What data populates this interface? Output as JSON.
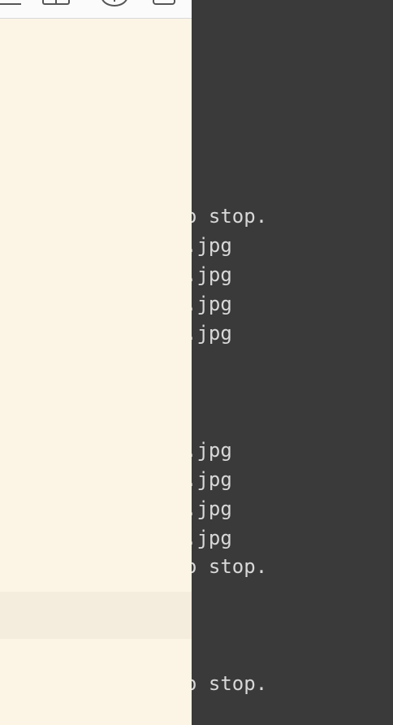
{
  "terminal": {
    "lines": [
      "o stop.",
      ".jpg",
      ".jpg",
      ".jpg",
      ".jpg",
      ".jpg",
      ".jpg",
      ".jpg",
      ".jpg",
      "o stop.",
      "o stop."
    ]
  },
  "colors": {
    "editor_background": "#fcf5e6",
    "editor_highlight": "#f4ecdd",
    "terminal_background": "#3a3a3a",
    "terminal_text": "#d8d8d8"
  },
  "icons": [
    "menu-icon",
    "book-icon",
    "info-icon",
    "window-icon"
  ]
}
